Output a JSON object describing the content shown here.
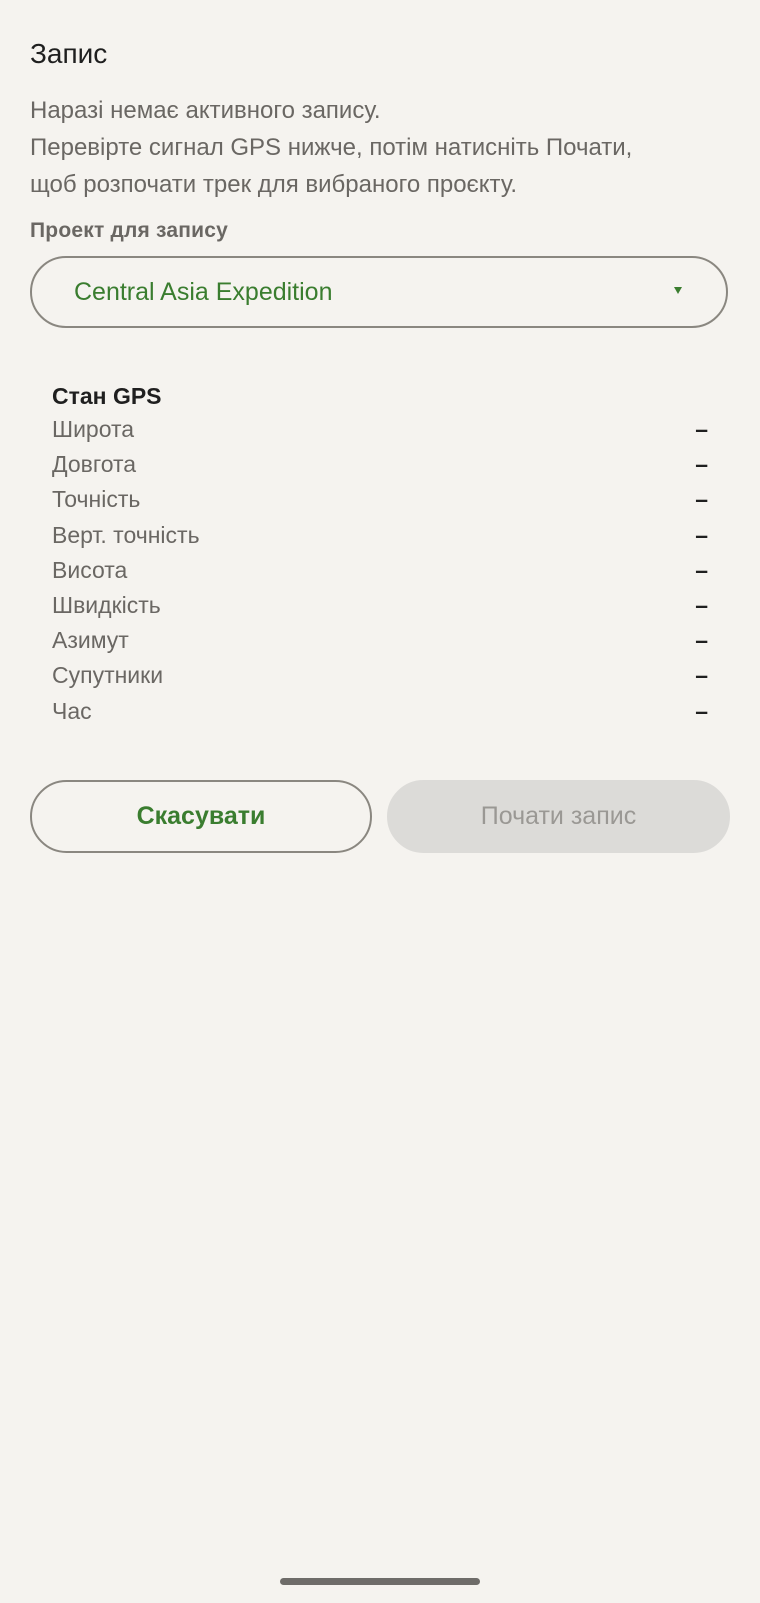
{
  "header": {
    "title": "Запис"
  },
  "description": {
    "line1": "Наразі немає активного запису.",
    "line2": "Перевірте сигнал GPS нижче, потім натисніть Почати,",
    "line3": "щоб розпочати трек для вибраного проєкту."
  },
  "project": {
    "label": "Проект для запису",
    "selected": "Central Asia Expedition",
    "arrow_icon": "dropdown-triangle-icon"
  },
  "gps": {
    "title": "Стан GPS",
    "rows": [
      {
        "label": "Широта",
        "value": "–"
      },
      {
        "label": "Довгота",
        "value": "–"
      },
      {
        "label": "Точність",
        "value": "–"
      },
      {
        "label": "Верт. точність",
        "value": "–"
      },
      {
        "label": "Висота",
        "value": "–"
      },
      {
        "label": "Швидкість",
        "value": "–"
      },
      {
        "label": "Азимут",
        "value": "–"
      },
      {
        "label": "Супутники",
        "value": "–"
      },
      {
        "label": "Час",
        "value": "–"
      }
    ]
  },
  "actions": {
    "cancel_label": "Скасувати",
    "start_label": "Почати запис"
  },
  "colors": {
    "background": "#f5f3ef",
    "accent": "#3a7d2f",
    "muted_text": "#6a6763",
    "disabled_bg": "#dcdbd8",
    "disabled_text": "#9a9894"
  }
}
